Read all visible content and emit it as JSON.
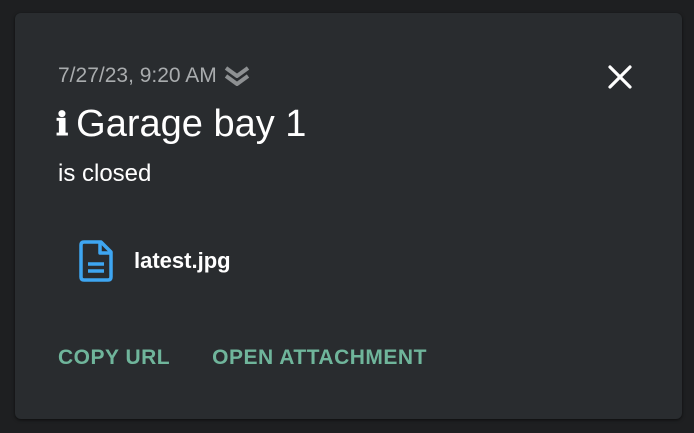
{
  "notification": {
    "timestamp": "7/27/23, 9:20 AM",
    "icon": "info-icon",
    "info_glyph": "ℹ",
    "title": "Garage bay 1",
    "message": "is closed",
    "attachment": {
      "icon": "file-document-icon",
      "name": "latest.jpg",
      "icon_color": "#3ea6f2"
    },
    "actions": {
      "copy_url": "COPY URL",
      "open_attachment": "OPEN ATTACHMENT"
    },
    "colors": {
      "background": "#292c2f",
      "accent": "#6fb59b",
      "muted_text": "#a9acae"
    }
  }
}
